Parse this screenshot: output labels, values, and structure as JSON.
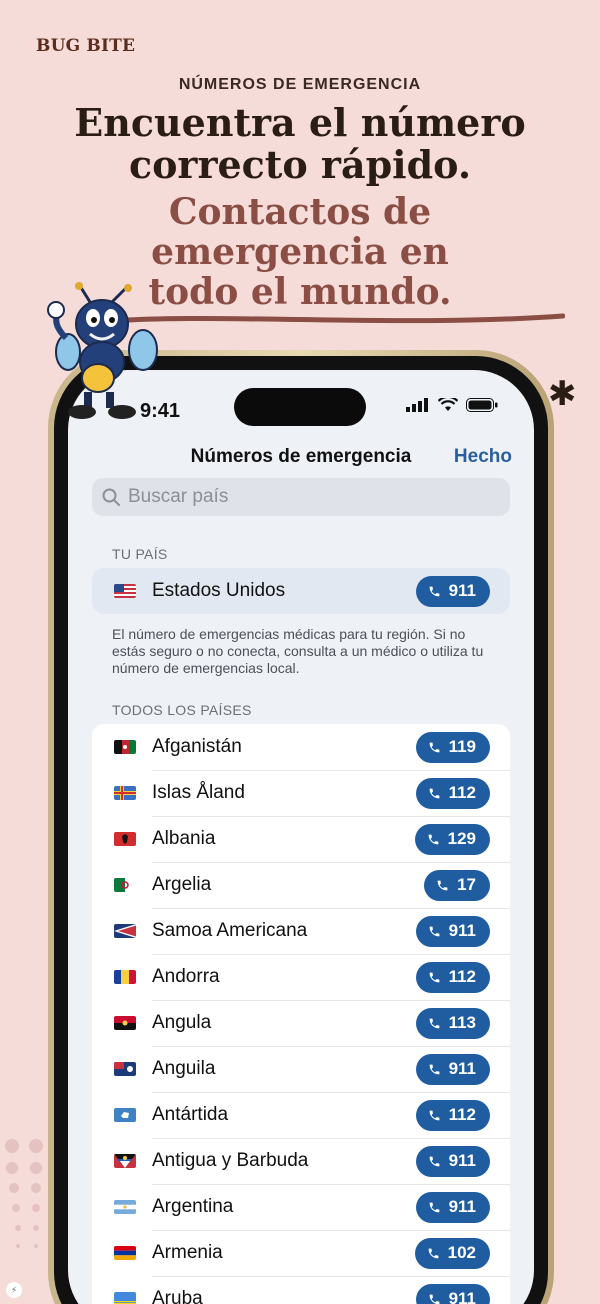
{
  "brand": "BUG BITE",
  "eyebrow": "NÚMEROS DE EMERGENCIA",
  "headline_line1": "Encuentra el número",
  "headline_line2": "correcto rápido.",
  "subhead_line1": "Contactos de",
  "subhead_line2": "emergencia en",
  "subhead_line3": "todo el mundo.",
  "colors": {
    "background": "#f6dcd9",
    "accent_blue": "#1f5da0",
    "subhead": "#8a4e45"
  },
  "status_bar": {
    "time": "9:41"
  },
  "nav": {
    "title": "Números de emergencia",
    "done_label": "Hecho"
  },
  "search": {
    "placeholder": "Buscar país",
    "value": ""
  },
  "my_country": {
    "section_label": "TU PAÍS",
    "name": "Estados Unidos",
    "number": "911",
    "flag_icon": "flag-us",
    "note": "El número de emergencias médicas para tu región. Si no estás seguro o no conecta, consulta a un médico o utiliza tu número de emergencias local."
  },
  "all_countries": {
    "section_label": "TODOS LOS PAÍSES",
    "items": [
      {
        "name": "Afganistán",
        "number": "119",
        "flag_icon": "flag-af"
      },
      {
        "name": "Islas Åland",
        "number": "112",
        "flag_icon": "flag-ax"
      },
      {
        "name": "Albania",
        "number": "129",
        "flag_icon": "flag-al"
      },
      {
        "name": "Argelia",
        "number": "17",
        "flag_icon": "flag-dz"
      },
      {
        "name": "Samoa Americana",
        "number": "911",
        "flag_icon": "flag-as"
      },
      {
        "name": "Andorra",
        "number": "112",
        "flag_icon": "flag-ad"
      },
      {
        "name": "Angula",
        "number": "113",
        "flag_icon": "flag-ao"
      },
      {
        "name": "Anguila",
        "number": "911",
        "flag_icon": "flag-ai"
      },
      {
        "name": "Antártida",
        "number": "112",
        "flag_icon": "flag-aq"
      },
      {
        "name": "Antigua y Barbuda",
        "number": "911",
        "flag_icon": "flag-ag"
      },
      {
        "name": "Argentina",
        "number": "911",
        "flag_icon": "flag-ar"
      },
      {
        "name": "Armenia",
        "number": "102",
        "flag_icon": "flag-am"
      },
      {
        "name": "Aruba",
        "number": "911",
        "flag_icon": "flag-aw"
      }
    ]
  }
}
